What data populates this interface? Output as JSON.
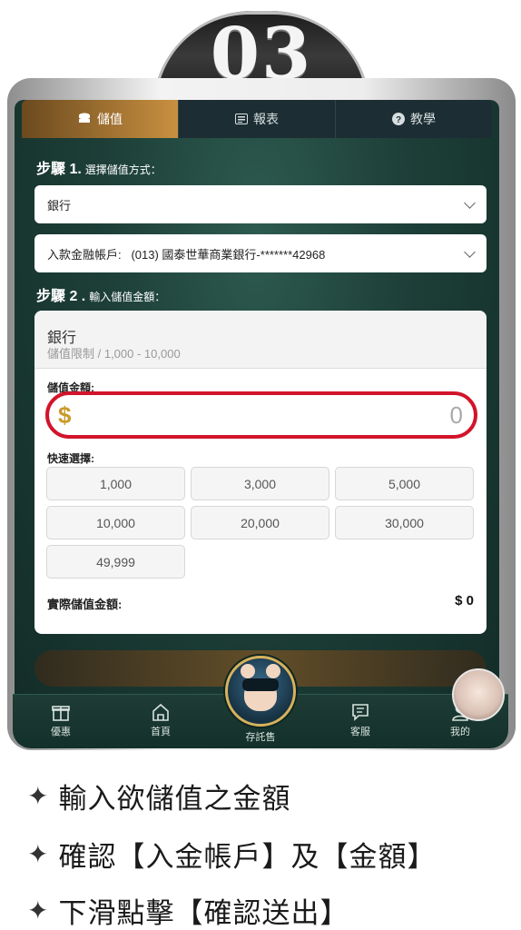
{
  "step_badge": {
    "number": "03"
  },
  "tabs": [
    {
      "icon": "coins-icon",
      "label": "儲值",
      "active": true
    },
    {
      "icon": "report-icon",
      "label": "報表",
      "active": false
    },
    {
      "icon": "question-icon",
      "label": "教學",
      "active": false
    }
  ],
  "step1": {
    "title": "步驟 1.",
    "subtitle": "選擇儲值方式："
  },
  "method_select": {
    "value": "銀行"
  },
  "account_select": {
    "label": "入款金融帳戶:",
    "value": "(013) 國泰世華商業銀行-*******42968"
  },
  "step2": {
    "title": "步驟 2 .",
    "subtitle": "輸入儲值金額："
  },
  "amount_card": {
    "bank_name": "銀行",
    "limit": "儲值限制 / 1,000 - 10,000",
    "amount_label": "儲值金額:",
    "currency_symbol": "$",
    "amount_value": "0",
    "quick_label": "快速選擇:",
    "quick_options": [
      "1,000",
      "3,000",
      "5,000",
      "10,000",
      "20,000",
      "30,000",
      "49,999"
    ],
    "actual_label": "實際儲值金額:",
    "actual_value": "$ 0"
  },
  "bottom_nav": [
    {
      "icon": "gift-icon",
      "label": "優惠"
    },
    {
      "icon": "home-icon",
      "label": "首頁"
    },
    {
      "icon": "avatar-icon",
      "label": "存託售"
    },
    {
      "icon": "chat-icon",
      "label": "客服"
    },
    {
      "icon": "user-icon",
      "label": "我的"
    }
  ],
  "instructions": [
    "輸入欲儲值之金額",
    "確認【入金帳戶】及【金額】",
    "下滑點擊【確認送出】"
  ],
  "colors": {
    "accent": "#c99040",
    "highlight_border": "#d2142a",
    "background_green": "#1d3f38"
  }
}
